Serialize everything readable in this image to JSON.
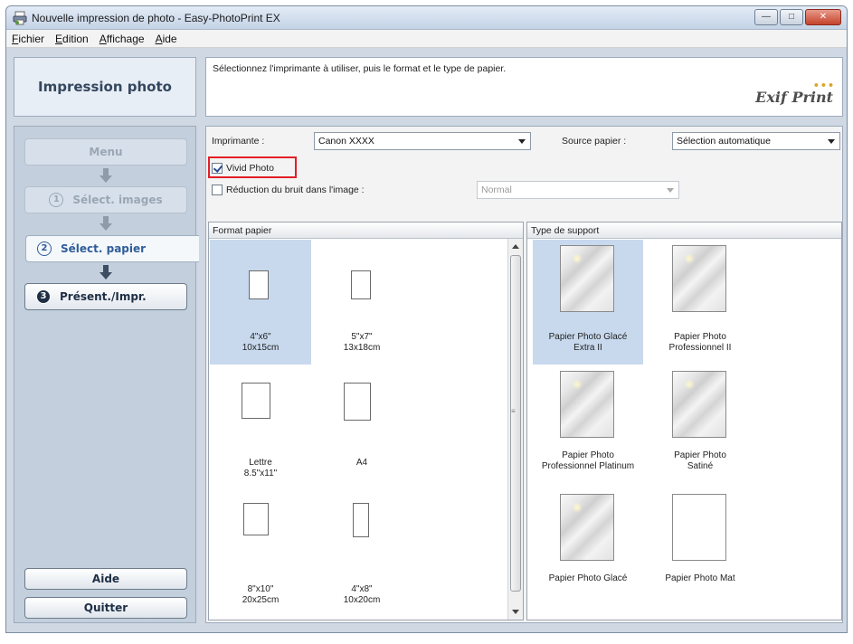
{
  "window": {
    "title": "Nouvelle impression de photo - Easy-PhotoPrint EX",
    "buttons": {
      "minimize": "—",
      "maximize": "□",
      "close": "✕"
    }
  },
  "menu": [
    "Fichier",
    "Edition",
    "Affichage",
    "Aide"
  ],
  "sidebar": {
    "header": "Impression photo",
    "menu_label": "Menu",
    "steps": [
      {
        "num": "1",
        "label": "Sélect. images"
      },
      {
        "num": "2",
        "label": "Sélect. papier"
      },
      {
        "num": "3",
        "label": "Présent./Impr."
      }
    ],
    "help": "Aide",
    "quit": "Quitter"
  },
  "instruction": "Sélectionnez l'imprimante à utiliser, puis le format et le type de papier.",
  "logo": {
    "text": "Exif Print",
    "dots": "•••"
  },
  "settings": {
    "printer_label": "Imprimante :",
    "printer_value": "Canon XXXX",
    "source_label": "Source papier :",
    "source_value": "Sélection automatique",
    "vivid_label": "Vivid Photo",
    "vivid_checked": true,
    "noise_label": "Réduction du bruit dans l'image :",
    "noise_checked": false,
    "noise_value": "Normal"
  },
  "paper_size": {
    "header": "Format papier",
    "items": [
      {
        "line1": "4\"x6\"",
        "line2": "10x15cm",
        "selected": true
      },
      {
        "line1": "5\"x7\"",
        "line2": "13x18cm",
        "selected": false
      },
      {
        "line1": "Lettre",
        "line2": "8.5\"x11\"",
        "selected": false
      },
      {
        "line1": "A4",
        "line2": "",
        "selected": false
      },
      {
        "line1": "8\"x10\"",
        "line2": "20x25cm",
        "selected": false
      },
      {
        "line1": "4\"x8\"",
        "line2": "10x20cm",
        "selected": false
      }
    ]
  },
  "media_type": {
    "header": "Type de support",
    "items": [
      {
        "line1": "Papier Photo Glacé",
        "line2": "Extra II",
        "selected": true
      },
      {
        "line1": "Papier Photo",
        "line2": "Professionnel II",
        "selected": false
      },
      {
        "line1": "Papier Photo",
        "line2": "Professionnel Platinum",
        "selected": false
      },
      {
        "line1": "Papier Photo",
        "line2": "Satiné",
        "selected": false
      },
      {
        "line1": "Papier Photo Glacé",
        "line2": "",
        "selected": false
      },
      {
        "line1": "Papier Photo Mat",
        "line2": "",
        "selected": false
      }
    ]
  },
  "colors": {
    "highlight": "#e21e26",
    "selection": "#c8d9ee",
    "accent": "#2f5d9a"
  }
}
